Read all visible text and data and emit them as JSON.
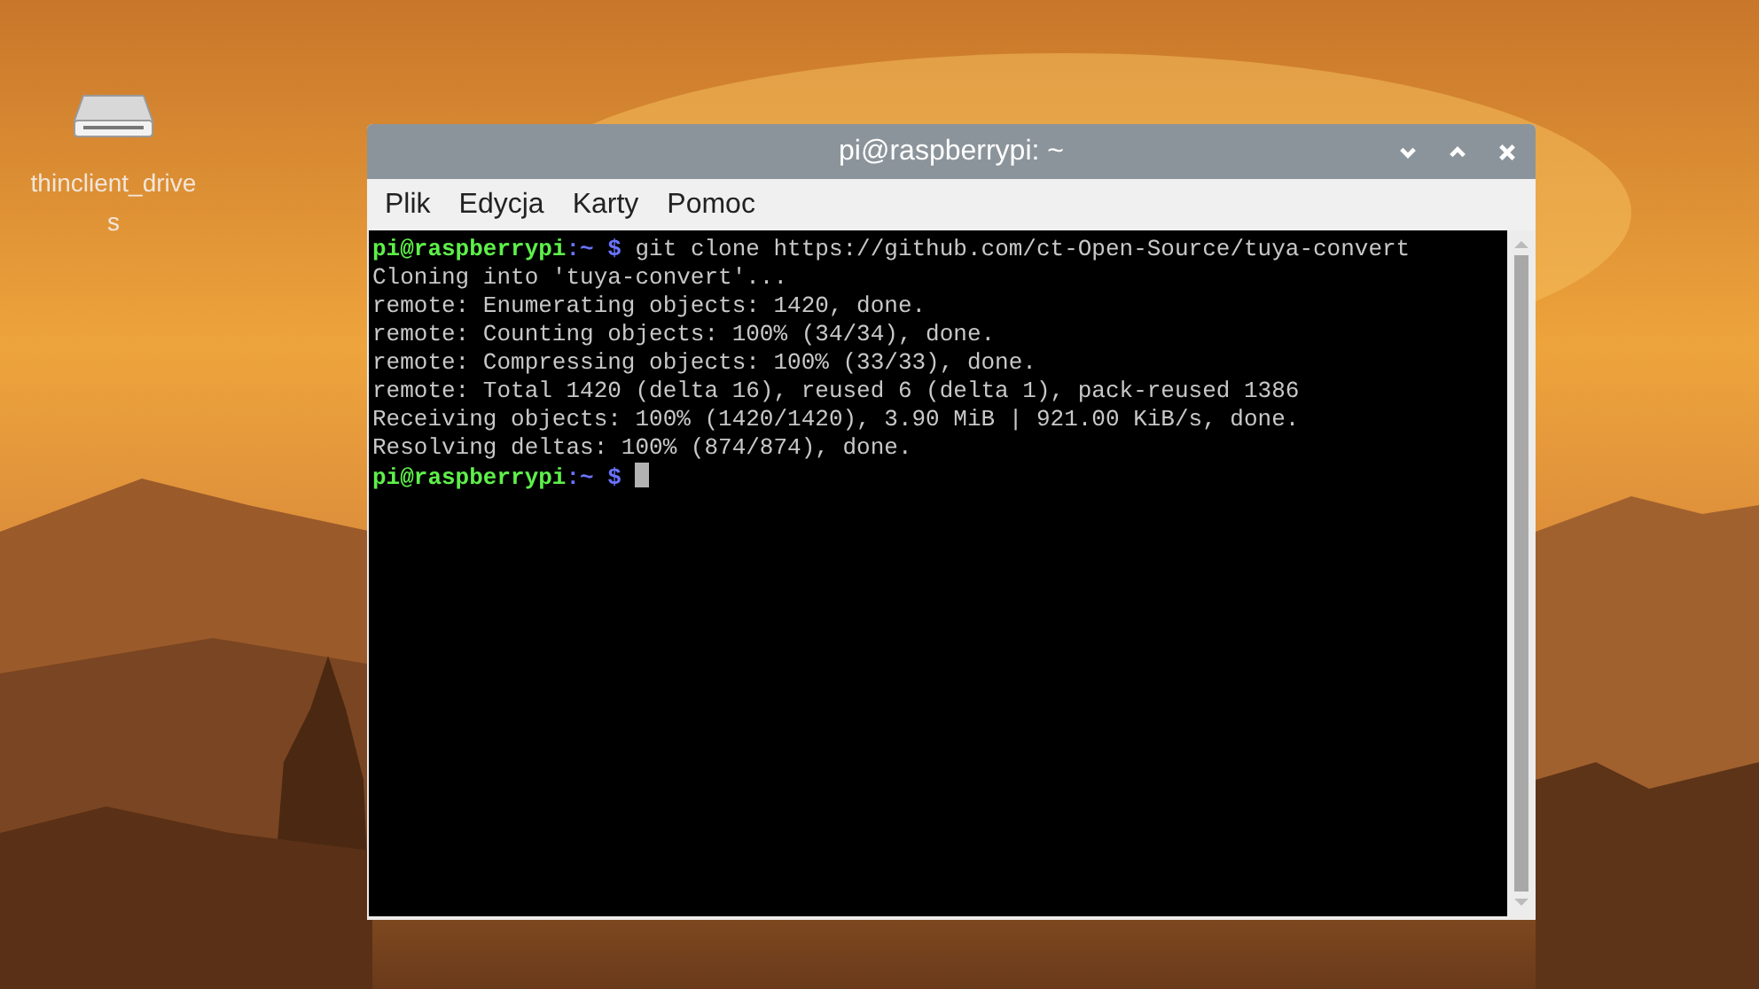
{
  "desktop": {
    "icons": [
      {
        "label": "thinclient_drives",
        "kind": "drive"
      }
    ]
  },
  "window": {
    "title": "pi@raspberrypi: ~"
  },
  "menu": [
    {
      "label": "Plik"
    },
    {
      "label": "Edycja"
    },
    {
      "label": "Karty"
    },
    {
      "label": "Pomoc"
    }
  ],
  "terminal": {
    "lines": [
      {
        "kind": "prompt",
        "user": "pi@raspberrypi",
        "path": ":~",
        "symbol": "$",
        "command": "git clone https://github.com/ct-Open-Source/tuya-convert"
      },
      {
        "kind": "output",
        "text": "Cloning into 'tuya-convert'..."
      },
      {
        "kind": "output",
        "text": "remote: Enumerating objects: 1420, done."
      },
      {
        "kind": "output",
        "text": "remote: Counting objects: 100% (34/34), done."
      },
      {
        "kind": "output",
        "text": "remote: Compressing objects: 100% (33/33), done."
      },
      {
        "kind": "output",
        "text": "remote: Total 1420 (delta 16), reused 6 (delta 1), pack-reused 1386"
      },
      {
        "kind": "output",
        "text": "Receiving objects: 100% (1420/1420), 3.90 MiB | 921.00 KiB/s, done."
      },
      {
        "kind": "output",
        "text": "Resolving deltas: 100% (874/874), done."
      },
      {
        "kind": "prompt",
        "user": "pi@raspberrypi",
        "path": ":~",
        "symbol": "$",
        "cursor": true
      }
    ]
  }
}
